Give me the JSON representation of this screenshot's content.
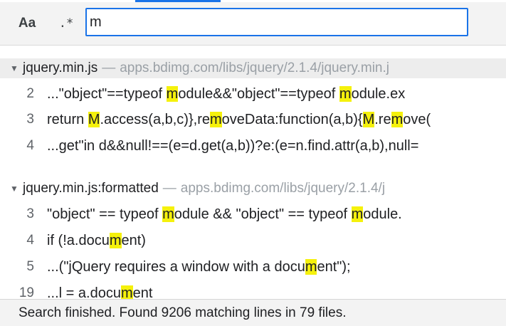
{
  "search": {
    "match_case_label": "Aa",
    "regex_label": ".*",
    "query": "m"
  },
  "colors": {
    "highlight": "#f5f10c",
    "focus_border": "#1a73e8"
  },
  "icons": {
    "expand_arrow": "triangle-down-icon"
  },
  "results": [
    {
      "file": "jquery.min.js",
      "separator": "—",
      "path": "apps.bdimg.com/libs/jquery/2.1.4/jquery.min.j",
      "lines": [
        {
          "num": "2",
          "segments": [
            "...\"object\"==typeof ",
            "m",
            "odule&&\"object\"==typeof ",
            "m",
            "odule.ex"
          ]
        },
        {
          "num": "3",
          "segments": [
            "return ",
            "M",
            ".access(a,b,c)},re",
            "m",
            "oveData:function(a,b){",
            "M",
            ".re",
            "m",
            "ove("
          ]
        },
        {
          "num": "4",
          "segments": [
            "...get\"in d&&null!==(e=d.get(a,b))?e:(e=n.find.attr(a,b),null="
          ]
        }
      ]
    },
    {
      "file": "jquery.min.js:formatted",
      "separator": "—",
      "path": "apps.bdimg.com/libs/jquery/2.1.4/j",
      "lines": [
        {
          "num": "3",
          "segments": [
            "\"object\" == typeof ",
            "m",
            "odule && \"object\" == typeof ",
            "m",
            "odule."
          ]
        },
        {
          "num": "4",
          "segments": [
            "if (!a.docu",
            "m",
            "ent)"
          ]
        },
        {
          "num": "5",
          "segments": [
            "...(\"jQuery requires a window with a docu",
            "m",
            "ent\");"
          ]
        },
        {
          "num": "19",
          "segments": [
            "...l = a.docu",
            "m",
            "ent"
          ]
        }
      ]
    }
  ],
  "status": {
    "text": "Search finished.  Found 9206 matching lines in 79 files."
  }
}
